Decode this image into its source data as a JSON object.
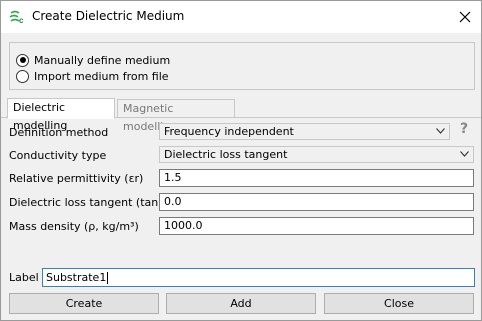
{
  "window": {
    "title": "Create Dielectric Medium",
    "app_icon": "cst-app-icon",
    "close_icon": "close-icon"
  },
  "medium_source": {
    "options": [
      {
        "label": "Manually define medium",
        "selected": true
      },
      {
        "label": "Import medium from file",
        "selected": false
      }
    ]
  },
  "tabs": [
    {
      "label": "Dielectric modelling",
      "active": true
    },
    {
      "label": "Magnetic modelling",
      "active": false
    }
  ],
  "form": {
    "definition_method": {
      "label": "Definition method",
      "value": "Frequency independent"
    },
    "conductivity_type": {
      "label": "Conductivity type",
      "value": "Dielectric loss tangent"
    },
    "relative_permittivity": {
      "label": "Relative permittivity (εr)",
      "value": "1.5"
    },
    "loss_tangent": {
      "label": "Dielectric loss tangent (tan δ)",
      "value": "0.0"
    },
    "mass_density": {
      "label": "Mass density (ρ, kg/m³)",
      "value": "1000.0"
    },
    "help_glyph": "?"
  },
  "label_field": {
    "label": "Label",
    "value": "Substrate1"
  },
  "buttons": {
    "create": "Create",
    "add": "Add",
    "close": "Close"
  }
}
